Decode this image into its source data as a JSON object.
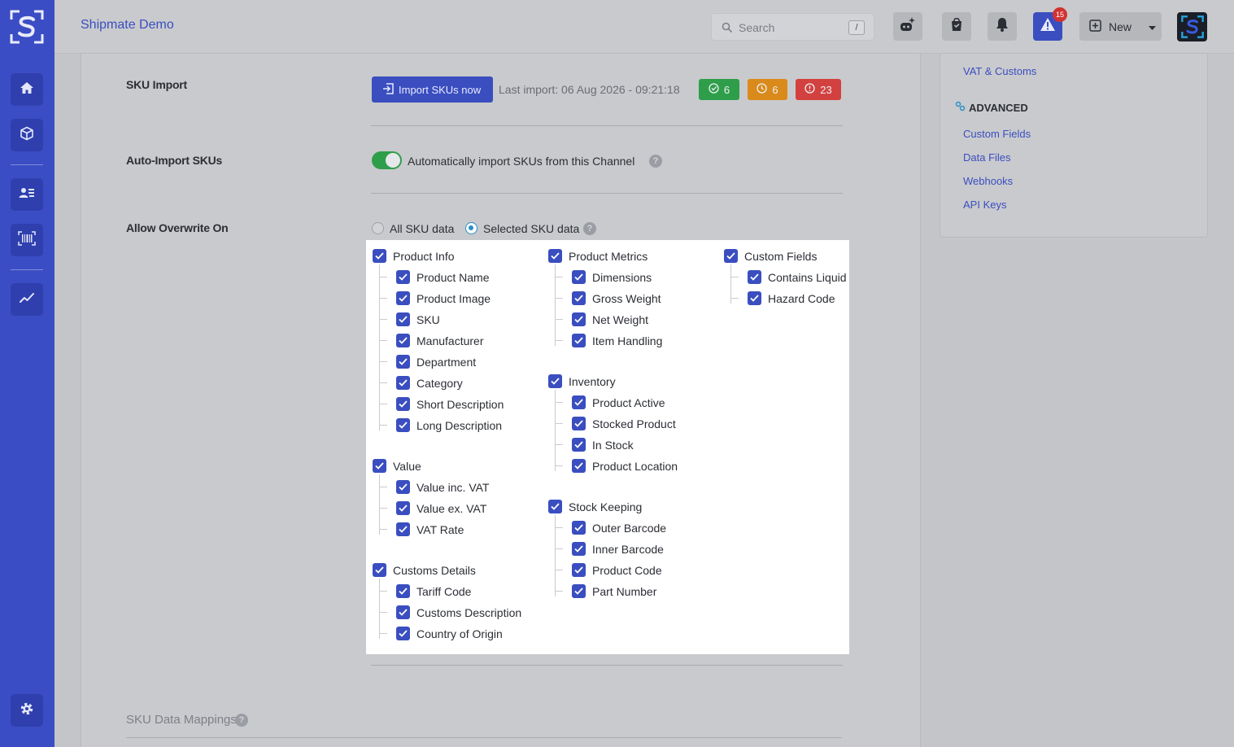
{
  "app": {
    "company_name": "Shipmate Demo"
  },
  "topbar": {
    "search_placeholder": "Search",
    "search_shortcut": "/",
    "alerts_count": "15",
    "new_label": "New"
  },
  "sku_import": {
    "label": "SKU Import",
    "button_label": "Import SKUs now",
    "last_import": "Last import: 06 Aug 2026 - 09:21:18",
    "success_count": "6",
    "pending_count": "6",
    "error_count": "23",
    "colors": {
      "success": "#2f9e4b",
      "pending": "#d98a1a",
      "error": "#d2413f"
    }
  },
  "auto_import": {
    "label": "Auto-Import SKUs",
    "toggle_text": "Automatically import SKUs from this Channel",
    "enabled": true
  },
  "overwrite": {
    "label": "Allow Overwrite On",
    "option_all": "All SKU data",
    "option_selected": "Selected SKU data",
    "selected": "Selected SKU data"
  },
  "groups": {
    "product_info": {
      "title": "Product Info",
      "items": [
        "Product Name",
        "Product Image",
        "SKU",
        "Manufacturer",
        "Department",
        "Category",
        "Short Description",
        "Long Description"
      ]
    },
    "value": {
      "title": "Value",
      "items": [
        "Value inc. VAT",
        "Value ex. VAT",
        "VAT Rate"
      ]
    },
    "customs_details": {
      "title": "Customs Details",
      "items": [
        "Tariff Code",
        "Customs Description",
        "Country of Origin"
      ]
    },
    "product_metrics": {
      "title": "Product Metrics",
      "items": [
        "Dimensions",
        "Gross Weight",
        "Net Weight",
        "Item Handling"
      ]
    },
    "inventory": {
      "title": "Inventory",
      "items": [
        "Product Active",
        "Stocked Product",
        "In Stock",
        "Product Location"
      ]
    },
    "stock_keeping": {
      "title": "Stock Keeping",
      "items": [
        "Outer Barcode",
        "Inner Barcode",
        "Product Code",
        "Part Number"
      ]
    },
    "custom_fields": {
      "title": "Custom Fields",
      "items": [
        "Contains Liquid",
        "Hazard Code"
      ]
    }
  },
  "sku_data_mappings": {
    "label": "SKU Data Mappings"
  },
  "right_nav": {
    "top_link": "VAT & Customs",
    "section_title": "ADVANCED",
    "links": [
      "Custom Fields",
      "Data Files",
      "Webhooks",
      "API Keys"
    ]
  },
  "colors": {
    "brand": "#3a4ec0",
    "checkbox": "#3a4ec0"
  }
}
